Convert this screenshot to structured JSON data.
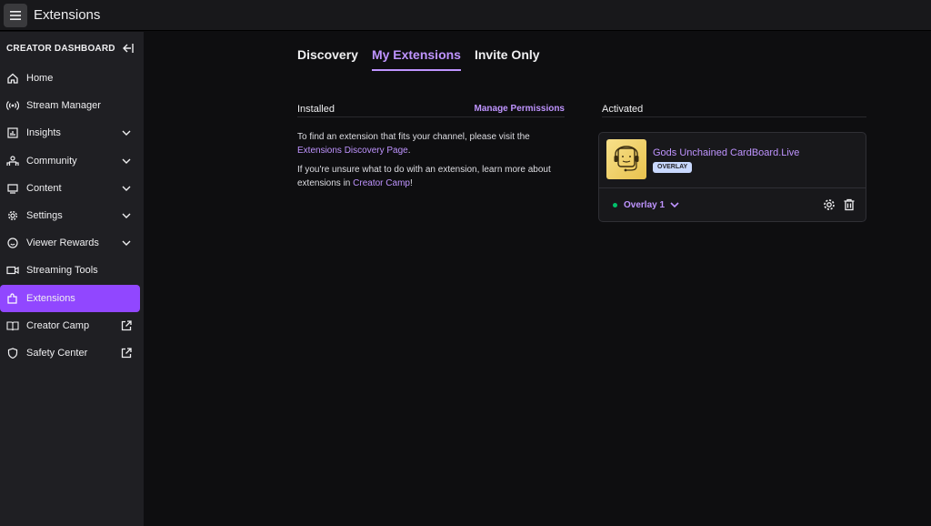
{
  "header": {
    "title": "Extensions",
    "menu_icon": "hamburger-icon"
  },
  "sidebar": {
    "heading": "CREATOR DASHBOARD",
    "collapse_icon": "collapse-left-icon",
    "items": [
      {
        "label": "Home",
        "icon": "home-icon",
        "expandable": false,
        "external": false,
        "active": false
      },
      {
        "label": "Stream Manager",
        "icon": "broadcast-icon",
        "expandable": false,
        "external": false,
        "active": false
      },
      {
        "label": "Insights",
        "icon": "chart-icon",
        "expandable": true,
        "external": false,
        "active": false
      },
      {
        "label": "Community",
        "icon": "people-icon",
        "expandable": true,
        "external": false,
        "active": false
      },
      {
        "label": "Content",
        "icon": "content-icon",
        "expandable": true,
        "external": false,
        "active": false
      },
      {
        "label": "Settings",
        "icon": "gear-icon",
        "expandable": true,
        "external": false,
        "active": false
      },
      {
        "label": "Viewer Rewards",
        "icon": "smiley-icon",
        "expandable": true,
        "external": false,
        "active": false
      },
      {
        "label": "Streaming Tools",
        "icon": "camera-icon",
        "expandable": false,
        "external": false,
        "active": false
      },
      {
        "label": "Extensions",
        "icon": "puzzle-icon",
        "expandable": false,
        "external": false,
        "active": true
      },
      {
        "label": "Creator Camp",
        "icon": "book-icon",
        "expandable": false,
        "external": true,
        "active": false
      },
      {
        "label": "Safety Center",
        "icon": "shield-icon",
        "expandable": false,
        "external": true,
        "active": false
      }
    ]
  },
  "tabs": [
    {
      "label": "Discovery",
      "active": false
    },
    {
      "label": "My Extensions",
      "active": true
    },
    {
      "label": "Invite Only",
      "active": false
    }
  ],
  "installed": {
    "heading": "Installed",
    "manage_link": "Manage Permissions",
    "para1_text": "To find an extension that fits your channel, please visit the",
    "para1_link": "Extensions Discovery Page",
    "para1_end": ".",
    "para2_text": "If you're unsure what to do with an extension, learn more about extensions in",
    "para2_link": "Creator Camp",
    "para2_end": "!"
  },
  "activated": {
    "heading": "Activated",
    "extension": {
      "name": "Gods Unchained CardBoard.Live",
      "badge": "OVERLAY",
      "slot_label": "Overlay 1",
      "status_color": "#00c16a",
      "thumb_icon": "headset-face-icon",
      "settings_icon": "gear-icon",
      "delete_icon": "trash-icon"
    }
  },
  "colors": {
    "accent": "#9147ff",
    "link": "#bf94ff",
    "background": "#0e0e10",
    "sidebar": "#1f1f23"
  }
}
